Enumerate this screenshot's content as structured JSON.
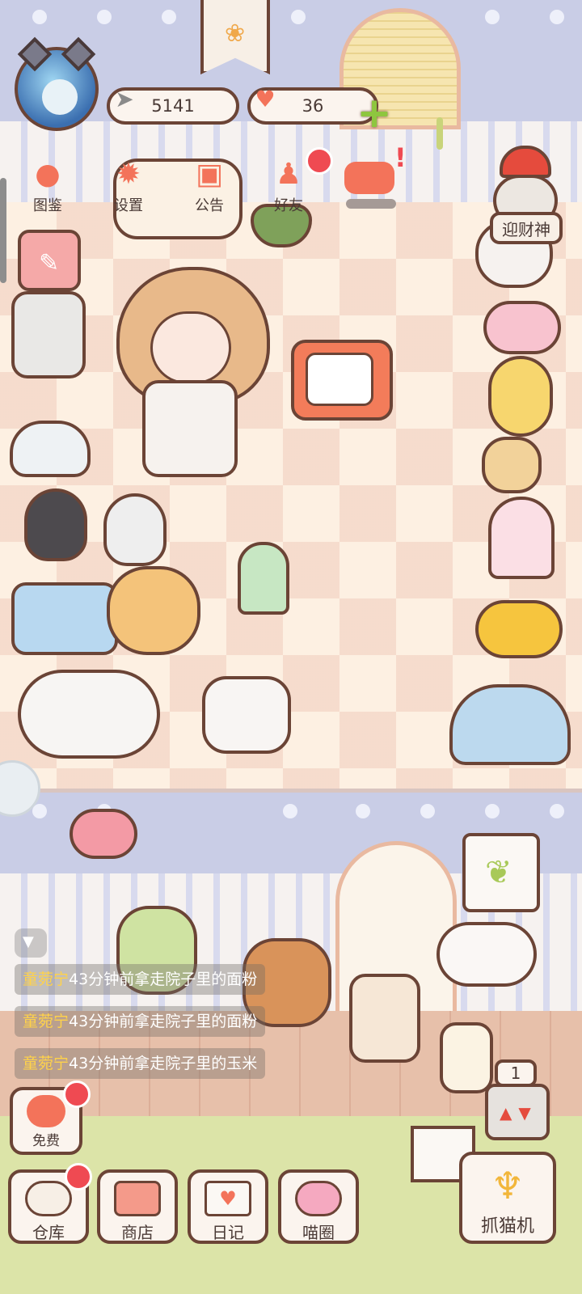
{
  "resources": {
    "fish": {
      "value": "5141",
      "icon": "fish-icon"
    },
    "hearts": {
      "value": "36",
      "icon": "heart-icon"
    }
  },
  "top_menu": [
    {
      "label": "图鉴",
      "icon": "cat-head-icon"
    },
    {
      "label": "设置",
      "icon": "gear-icon"
    },
    {
      "label": "公告",
      "icon": "gift-icon"
    },
    {
      "label": "好友",
      "icon": "friends-icon"
    }
  ],
  "side": {
    "god_label": "迎财神"
  },
  "chat_log": [
    {
      "name": "童菀宁",
      "message": "43分钟前拿走院子里的面粉"
    },
    {
      "name": "童菀宁",
      "message": "43分钟前拿走院子里的面粉"
    },
    {
      "name": "童菀宁",
      "message": "43分钟前拿走院子里的玉米"
    }
  ],
  "free_button": {
    "label": "免费"
  },
  "bottom_nav": [
    {
      "label": "仓库",
      "icon": "storage-icon",
      "badge": true
    },
    {
      "label": "商店",
      "icon": "shop-icon",
      "badge": false
    },
    {
      "label": "日记",
      "icon": "diary-icon",
      "badge": false
    },
    {
      "label": "喵圈",
      "icon": "planet-cat-icon",
      "badge": false
    }
  ],
  "claw_machine": {
    "label": "抓猫机",
    "count": "1"
  },
  "colors": {
    "accent": "#f3735a",
    "outline": "#6b4436",
    "badge": "#ef4a52",
    "plus": "#8ec63f",
    "chat_name": "#ffd24a"
  }
}
